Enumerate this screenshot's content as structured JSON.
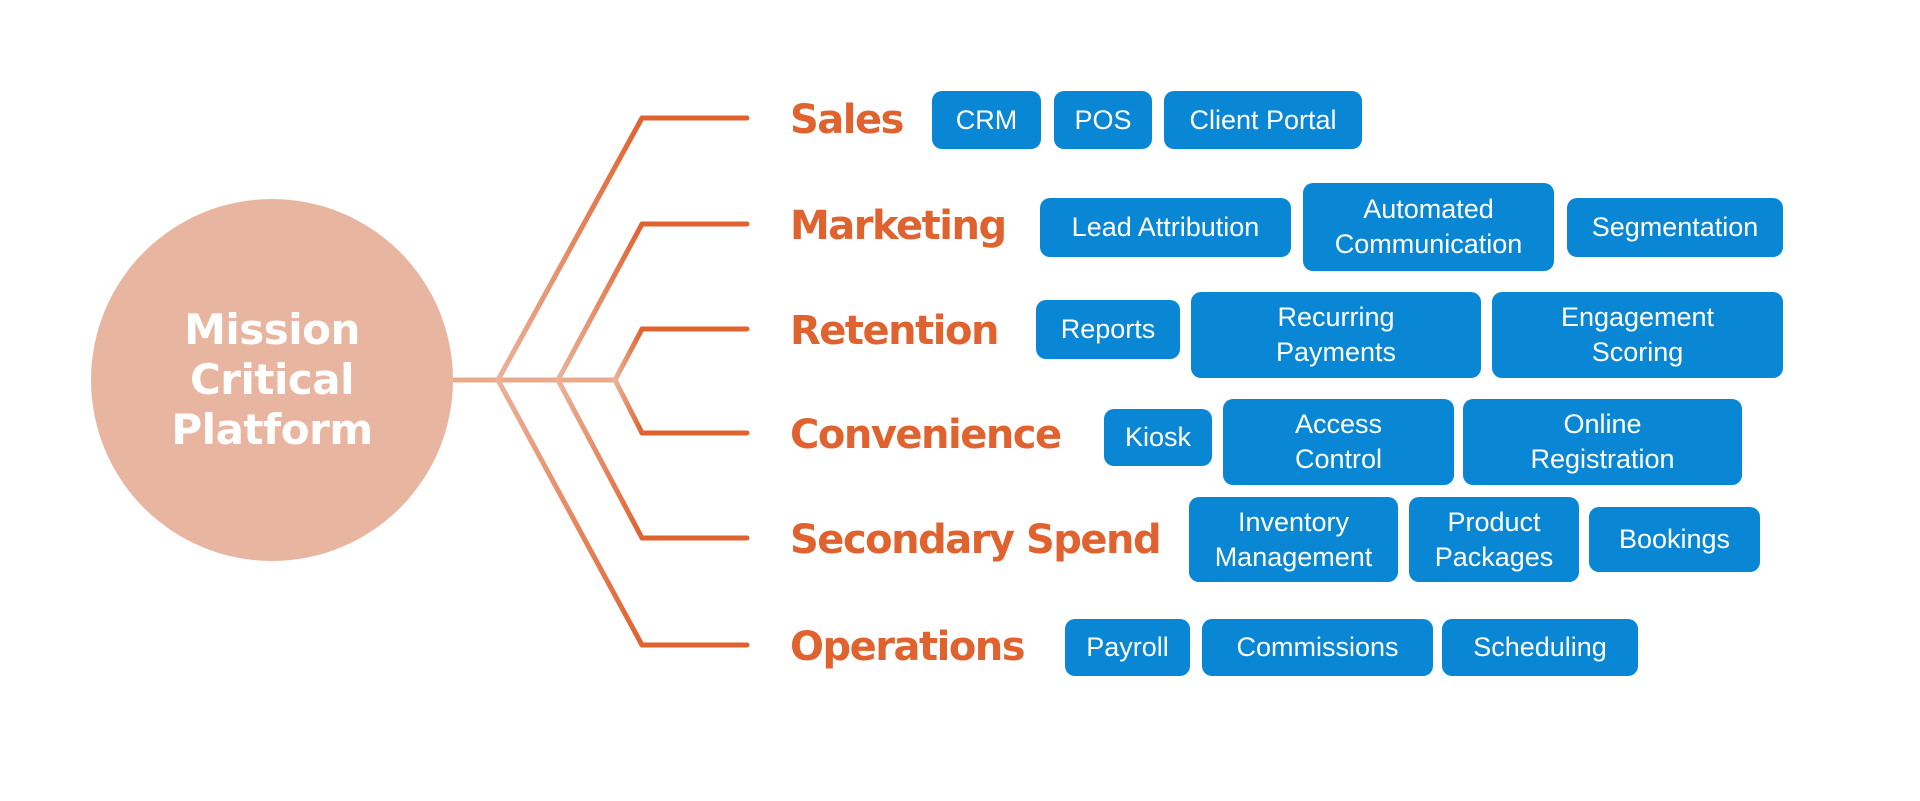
{
  "hub": {
    "title": "Mission\nCritical\nPlatform"
  },
  "colors": {
    "hub_fill": "#E8B6A0",
    "branch_light": "#E9A98A",
    "branch_dark": "#E0622F",
    "label": "#E0622F",
    "pill": "#0A87D4",
    "pill_text": "#FFFFFF"
  },
  "categories": [
    {
      "label": "Sales",
      "items": [
        "CRM",
        "POS",
        "Client Portal"
      ]
    },
    {
      "label": "Marketing",
      "items": [
        "Lead Attribution",
        "Automated\nCommunication",
        "Segmentation"
      ]
    },
    {
      "label": "Retention",
      "items": [
        "Reports",
        "Recurring\nPayments",
        "Engagement\nScoring"
      ]
    },
    {
      "label": "Convenience",
      "items": [
        "Kiosk",
        "Access\nControl",
        "Online\nRegistration"
      ]
    },
    {
      "label": "Secondary Spend",
      "items": [
        "Inventory\nManagement",
        "Product\nPackages",
        "Bookings"
      ]
    },
    {
      "label": "Operations",
      "items": [
        "Payroll",
        "Commissions",
        "Scheduling"
      ]
    }
  ]
}
